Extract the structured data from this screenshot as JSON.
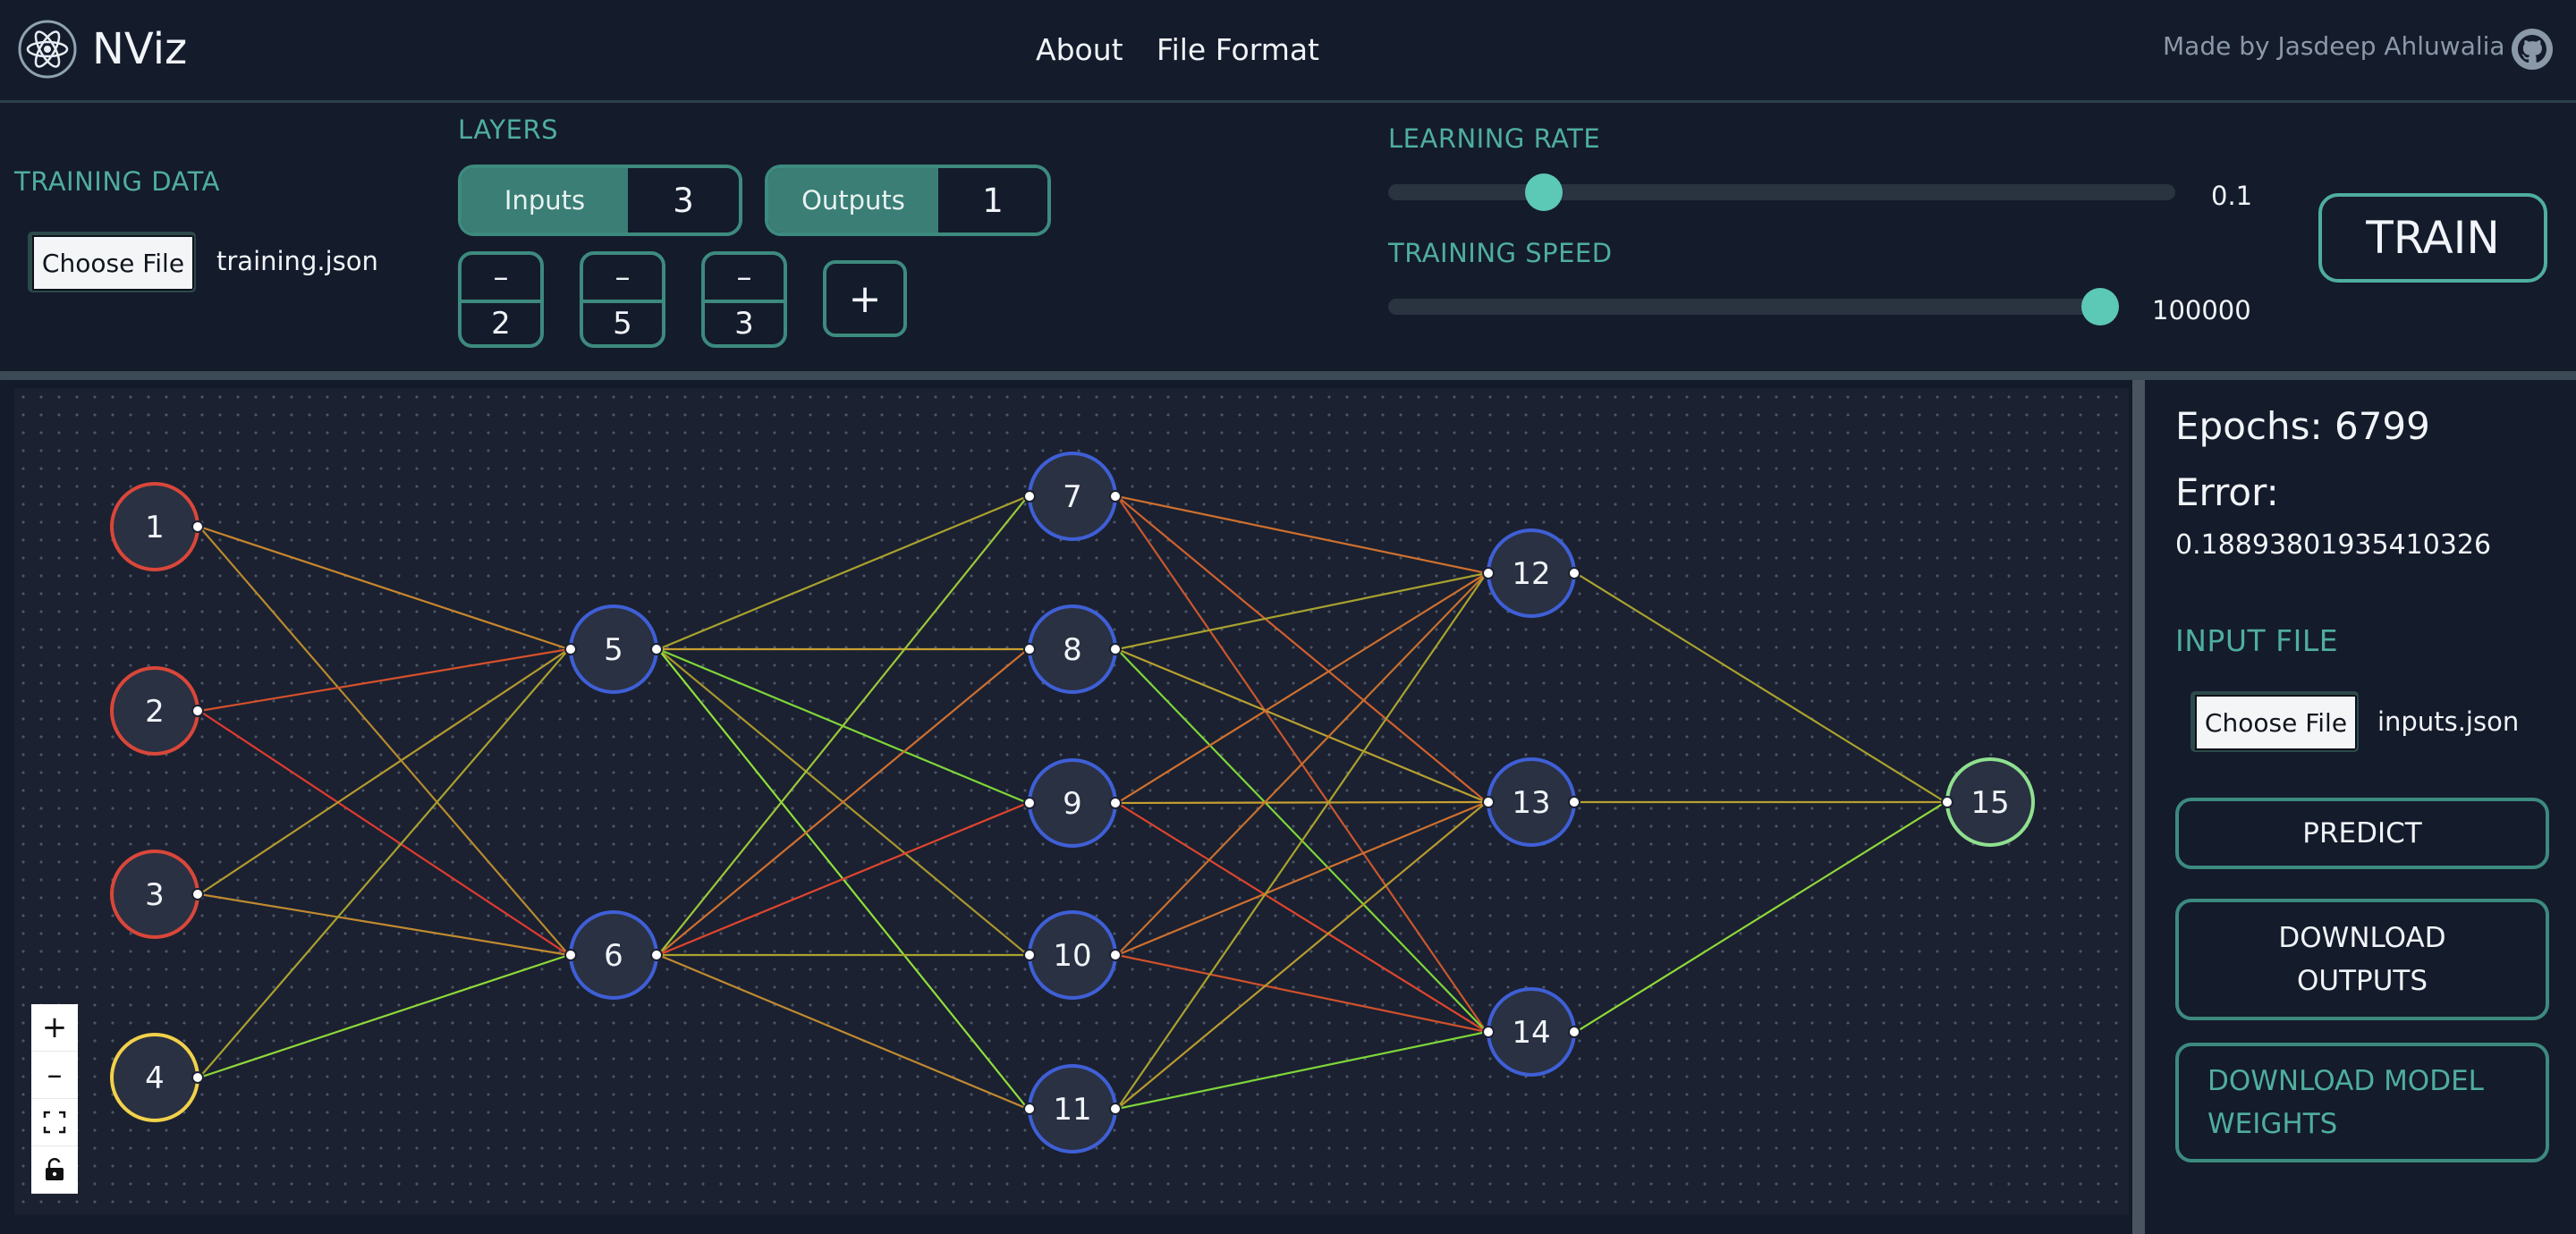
{
  "header": {
    "title": "NViz",
    "nav": {
      "about": "About",
      "file_format": "File Format"
    },
    "credit": "Made by Jasdeep Ahluwalia"
  },
  "training_data": {
    "label": "TRAINING DATA",
    "choose_file_label": "Choose File",
    "file_name": "training.json"
  },
  "layers": {
    "label": "LAYERS",
    "inputs_label": "Inputs",
    "inputs_value": "3",
    "outputs_label": "Outputs",
    "outputs_value": "1",
    "hidden": [
      {
        "minus": "–",
        "count": "2"
      },
      {
        "minus": "–",
        "count": "5"
      },
      {
        "minus": "–",
        "count": "3"
      }
    ],
    "add_label": "+"
  },
  "learning_rate": {
    "label": "LEARNING RATE",
    "value": "0.1",
    "slider_fraction": 0.11
  },
  "training_speed": {
    "label": "TRAINING SPEED",
    "value": "100000",
    "slider_fraction": 0.96
  },
  "train_button": "TRAIN",
  "zoom_controls": {
    "zoom_in": "+",
    "zoom_out": "–"
  },
  "stats": {
    "epochs_label": "Epochs: 6799",
    "error_label": "Error:",
    "error_value": "0.18893801935410326"
  },
  "input_file": {
    "label": "INPUT FILE",
    "choose_file_label": "Choose File",
    "file_name": "inputs.json"
  },
  "actions": {
    "predict": "PREDICT",
    "download_outputs": "DOWNLOAD OUTPUTS",
    "download_weights": "DOWNLOAD MODEL WEIGHTS"
  },
  "colors": {
    "accent": "#4fae9e",
    "input_node_border": "#d9473a",
    "selected_node_border": "#f2d14a",
    "hidden_node_border": "#3f5fd6",
    "output_node_border": "#8fe08f",
    "node_fill": "#2a3142"
  },
  "network": {
    "nodes": [
      {
        "id": "1",
        "layer": 0,
        "type": "input"
      },
      {
        "id": "2",
        "layer": 0,
        "type": "input"
      },
      {
        "id": "3",
        "layer": 0,
        "type": "input"
      },
      {
        "id": "4",
        "layer": 0,
        "type": "input-selected"
      },
      {
        "id": "5",
        "layer": 1,
        "type": "hidden"
      },
      {
        "id": "6",
        "layer": 1,
        "type": "hidden"
      },
      {
        "id": "7",
        "layer": 2,
        "type": "hidden"
      },
      {
        "id": "8",
        "layer": 2,
        "type": "hidden"
      },
      {
        "id": "9",
        "layer": 2,
        "type": "hidden"
      },
      {
        "id": "10",
        "layer": 2,
        "type": "hidden"
      },
      {
        "id": "11",
        "layer": 2,
        "type": "hidden"
      },
      {
        "id": "12",
        "layer": 3,
        "type": "hidden"
      },
      {
        "id": "13",
        "layer": 3,
        "type": "hidden"
      },
      {
        "id": "14",
        "layer": 3,
        "type": "hidden"
      },
      {
        "id": "15",
        "layer": 4,
        "type": "output"
      }
    ],
    "edges": [
      [
        "1",
        "5",
        "#c8872e"
      ],
      [
        "1",
        "6",
        "#b88a2e"
      ],
      [
        "2",
        "5",
        "#d7512c"
      ],
      [
        "2",
        "6",
        "#e03a30"
      ],
      [
        "3",
        "5",
        "#b39a2e"
      ],
      [
        "3",
        "6",
        "#c08a30"
      ],
      [
        "4",
        "5",
        "#a9a22e"
      ],
      [
        "4",
        "6",
        "#8fd93a"
      ],
      [
        "5",
        "7",
        "#a9a22e"
      ],
      [
        "5",
        "8",
        "#c8a030"
      ],
      [
        "5",
        "9",
        "#7ed63a"
      ],
      [
        "5",
        "10",
        "#a9962e"
      ],
      [
        "5",
        "11",
        "#8fe03a"
      ],
      [
        "6",
        "7",
        "#9cc83a"
      ],
      [
        "6",
        "8",
        "#d0702e"
      ],
      [
        "6",
        "9",
        "#e0452e"
      ],
      [
        "6",
        "10",
        "#a9a22e"
      ],
      [
        "6",
        "11",
        "#c08a30"
      ],
      [
        "7",
        "12",
        "#d0702e"
      ],
      [
        "7",
        "13",
        "#d0602e"
      ],
      [
        "7",
        "14",
        "#c8572e"
      ],
      [
        "8",
        "12",
        "#a9a22e"
      ],
      [
        "8",
        "13",
        "#b8a030"
      ],
      [
        "8",
        "14",
        "#7ed63a"
      ],
      [
        "9",
        "12",
        "#d0702e"
      ],
      [
        "9",
        "13",
        "#c8a030"
      ],
      [
        "9",
        "14",
        "#e0452e"
      ],
      [
        "10",
        "12",
        "#c8702e"
      ],
      [
        "10",
        "13",
        "#d0702e"
      ],
      [
        "10",
        "14",
        "#d0512c"
      ],
      [
        "11",
        "12",
        "#a9a22e"
      ],
      [
        "11",
        "13",
        "#b89a2e"
      ],
      [
        "11",
        "14",
        "#7ed63a"
      ],
      [
        "12",
        "15",
        "#a9a22e"
      ],
      [
        "13",
        "15",
        "#b8a030"
      ],
      [
        "14",
        "15",
        "#8fd93a"
      ]
    ]
  }
}
